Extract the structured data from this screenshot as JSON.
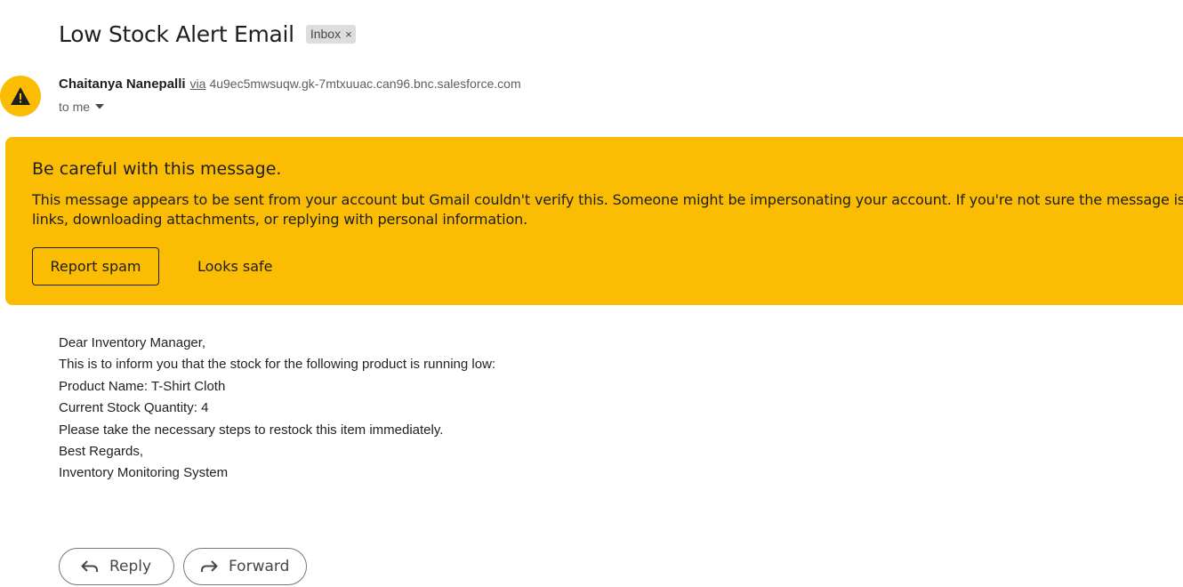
{
  "email": {
    "subject": "Low Stock Alert Email",
    "label": "Inbox",
    "label_remove": "×",
    "sender_name": "Chaitanya Nanepalli",
    "via_text": "via",
    "via_domain": "4u9ec5mwsuqw.gk-7mtxuuac.can96.bnc.salesforce.com",
    "recipient": "to me"
  },
  "warning": {
    "title": "Be careful with this message.",
    "line1": "This message appears to be sent from your account but Gmail couldn't verify this. Someone might be impersonating your account. If you're not sure the message is",
    "line2": "links, downloading attachments, or replying with personal information.",
    "report_spam_label": "Report spam",
    "looks_safe_label": "Looks safe",
    "color": "#fbbc04"
  },
  "body": {
    "lines": [
      "Dear Inventory Manager,",
      "This is to inform you that the stock for the following product is running low:",
      "Product Name: T-Shirt Cloth",
      "Current Stock Quantity: 4",
      "Please take the necessary steps to restock this item immediately.",
      "Best Regards,",
      "Inventory Monitoring System"
    ]
  },
  "actions": {
    "reply_label": "Reply",
    "forward_label": "Forward"
  },
  "icons": {
    "avatar": "warning-triangle-icon",
    "recipient_toggle": "caret-down-icon",
    "reply": "reply-arrow-icon",
    "forward": "forward-arrow-icon"
  }
}
